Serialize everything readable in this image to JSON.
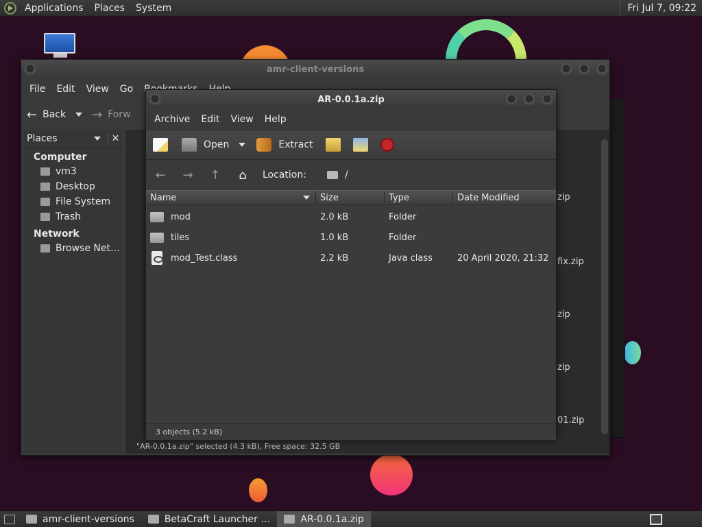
{
  "top_panel": {
    "menus": [
      "Applications",
      "Places",
      "System"
    ],
    "clock": "Fri Jul  7, 09:22"
  },
  "background_window": {
    "title": "amr-client-versions",
    "menus": [
      "File",
      "Edit",
      "View",
      "Go",
      "Bookmarks",
      "Help"
    ],
    "toolbar": {
      "back": "Back",
      "forward": "Forw"
    },
    "sidebar": {
      "header": "Places",
      "sections": [
        {
          "title": "Computer",
          "items": [
            "vm3",
            "Desktop",
            "File System",
            "Trash"
          ]
        },
        {
          "title": "Network",
          "items": [
            "Browse Net…"
          ]
        }
      ]
    },
    "visible_names": [
      "zip",
      "fix.zip",
      "zip",
      "zip",
      "01.zip"
    ],
    "status": "\"AR-0.0.1a.zip\" selected (4.3 kB), Free space: 32.5 GB"
  },
  "archive_window": {
    "title": "AR-0.0.1a.zip",
    "menus": [
      "Archive",
      "Edit",
      "View",
      "Help"
    ],
    "toolbar": {
      "open": "Open",
      "extract": "Extract"
    },
    "location_label": "Location:",
    "location_value": "/",
    "columns": {
      "name": "Name",
      "size": "Size",
      "type": "Type",
      "date": "Date Modified"
    },
    "files": [
      {
        "name": "mod",
        "size": "2.0 kB",
        "type": "Folder",
        "date": "",
        "icon": "folder-icon"
      },
      {
        "name": "tiles",
        "size": "1.0 kB",
        "type": "Folder",
        "date": "",
        "icon": "folder-icon"
      },
      {
        "name": "mod_Test.class",
        "size": "2.2 kB",
        "type": "Java class",
        "date": "20 April 2020, 21:32",
        "icon": "java-file-icon"
      }
    ],
    "status": "3 objects (5.2 kB)"
  },
  "taskbar": {
    "tasks": [
      "amr-client-versions",
      "BetaCraft Launcher …",
      "AR-0.0.1a.zip"
    ]
  }
}
